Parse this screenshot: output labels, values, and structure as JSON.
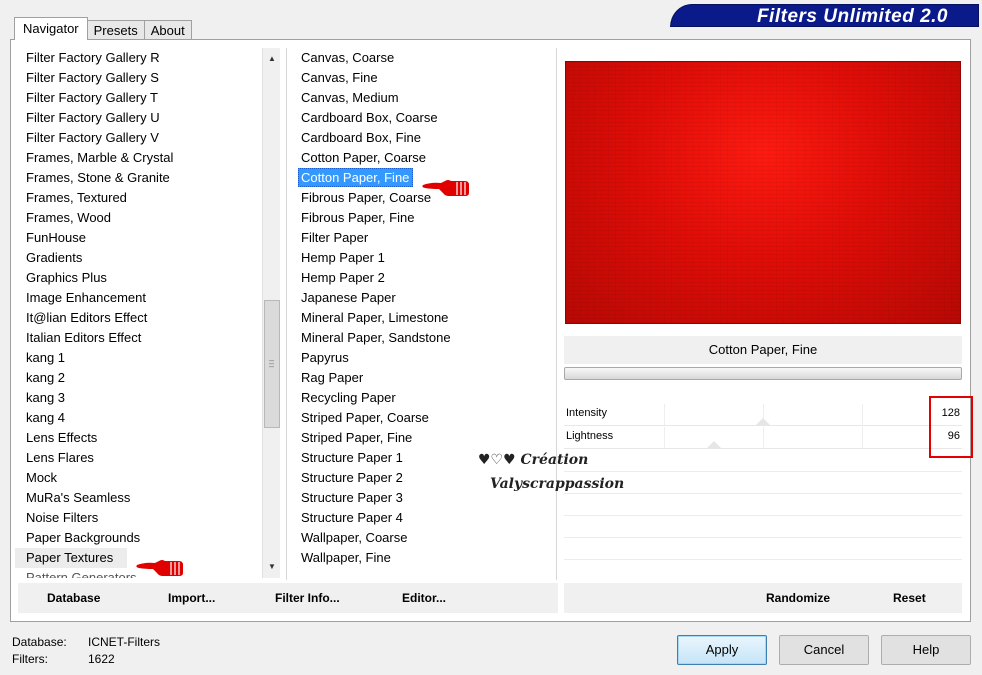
{
  "app": {
    "banner_title": "Filters Unlimited 2.0"
  },
  "tabs": [
    {
      "label": "Navigator"
    },
    {
      "label": "Presets"
    },
    {
      "label": "About"
    }
  ],
  "categories": [
    "Filter Factory Gallery R",
    "Filter Factory Gallery S",
    "Filter Factory Gallery T",
    "Filter Factory Gallery U",
    "Filter Factory Gallery V",
    "Frames, Marble & Crystal",
    "Frames, Stone & Granite",
    "Frames, Textured",
    "Frames, Wood",
    "FunHouse",
    "Gradients",
    "Graphics Plus",
    "Image Enhancement",
    "It@lian Editors Effect",
    "Italian Editors Effect",
    "kang 1",
    "kang 2",
    "kang 3",
    "kang 4",
    "Lens Effects",
    "Lens Flares",
    "Mock",
    "MuRa's Seamless",
    "Noise Filters",
    "Paper Backgrounds",
    "Paper Textures",
    "Pattern Generators"
  ],
  "filters": [
    "Canvas, Coarse",
    "Canvas, Fine",
    "Canvas, Medium",
    "Cardboard Box, Coarse",
    "Cardboard Box, Fine",
    "Cotton Paper, Coarse",
    "Cotton Paper, Fine",
    "Fibrous Paper, Coarse",
    "Fibrous Paper, Fine",
    "Filter Paper",
    "Hemp Paper 1",
    "Hemp Paper 2",
    "Japanese Paper",
    "Mineral Paper, Limestone",
    "Mineral Paper, Sandstone",
    "Papyrus",
    "Rag Paper",
    "Recycling Paper",
    "Striped Paper, Coarse",
    "Striped Paper, Fine",
    "Structure Paper 1",
    "Structure Paper 2",
    "Structure Paper 3",
    "Structure Paper 4",
    "Wallpaper, Coarse",
    "Wallpaper, Fine"
  ],
  "selected_filter_name": "Cotton Paper, Fine",
  "sliders": [
    {
      "label": "Intensity",
      "value": "128",
      "fraction": 0.5
    },
    {
      "label": "Lightness",
      "value": "96",
      "fraction": 0.376
    }
  ],
  "watermark": {
    "line1": "♥♡♥ Création",
    "line2": "Valyscrappassion"
  },
  "left_buttons": {
    "database": "Database",
    "import": "Import...",
    "filter_info": "Filter Info...",
    "editor": "Editor..."
  },
  "right_buttons": {
    "randomize": "Randomize",
    "reset": "Reset"
  },
  "status": {
    "database_label": "Database:",
    "database_value": "ICNET-Filters",
    "filters_label": "Filters:",
    "filters_value": "1622"
  },
  "dialog_buttons": {
    "apply": "Apply",
    "cancel": "Cancel",
    "help": "Help"
  },
  "colors": {
    "banner": "#0a1a8a",
    "selection": "#3399ff",
    "highlight_box": "#e30000",
    "preview_red": "#e00c06"
  }
}
